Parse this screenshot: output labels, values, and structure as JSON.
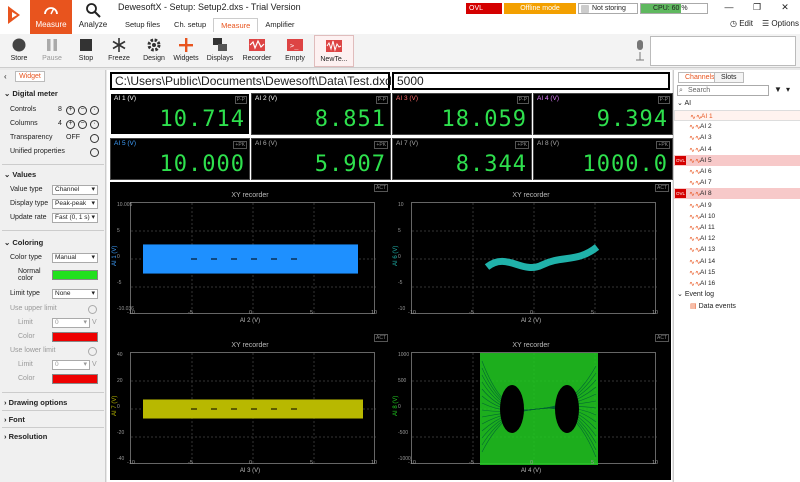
{
  "window": {
    "title": "DewesoftX - Setup: Setup2.dxs - Trial Version"
  },
  "ribbon": {
    "big_tabs": [
      {
        "label": "Measure"
      },
      {
        "label": "Analyze"
      }
    ],
    "sub_tabs": [
      "Setup files",
      "Ch. setup",
      "Measure",
      "Amplifier"
    ],
    "active_sub_tab": "Measure"
  },
  "status": {
    "ovl": "OVL",
    "mode": "Offline mode",
    "storing": "Not storing",
    "cpu": "CPU: 60 %",
    "cpu_percent": 60
  },
  "header_actions": {
    "edit": "Edit",
    "options": "Options"
  },
  "toolbar": {
    "store": "Store",
    "pause": "Pause",
    "stop": "Stop",
    "freeze": "Freeze",
    "design": "Design",
    "widgets": "Widgets",
    "displays": "Displays",
    "recorder": "Recorder",
    "empty": "Empty",
    "new_temp": "NewTe..."
  },
  "left_panel": {
    "tab": "Widget",
    "digital_meter": {
      "title": "Digital meter",
      "controls_label": "Controls",
      "controls_value": "8",
      "columns_label": "Columns",
      "columns_value": "4",
      "transparency_label": "Transparency",
      "transparency_value": "OFF",
      "unified_label": "Unified properties"
    },
    "values": {
      "title": "Values",
      "value_type_label": "Value type",
      "value_type": "Channel",
      "display_type_label": "Display type",
      "display_type": "Peak-peak",
      "update_rate_label": "Update rate",
      "update_rate": "Fast (0, 1 s)"
    },
    "coloring": {
      "title": "Coloring",
      "color_type_label": "Color type",
      "color_type": "Manual",
      "normal_color_label": "Normal color",
      "normal_color": "#22e01e",
      "limit_type_label": "Limit type",
      "limit_type": "None",
      "use_upper_label": "Use upper limit",
      "upper_limit_label": "Limit",
      "upper_limit_value": "0",
      "upper_unit": "V",
      "upper_color_label": "Color",
      "upper_color": "#ee0000",
      "use_lower_label": "Use lower limit",
      "lower_limit_label": "Limit",
      "lower_limit_value": "0",
      "lower_unit": "V",
      "lower_color_label": "Color",
      "lower_color": "#ee0000"
    },
    "drawing_options": "Drawing options",
    "font": "Font",
    "resolution": "Resolution"
  },
  "main": {
    "path_text": "C:\\Users\\Public\\Documents\\Dewesoft\\Data\\Test.dxd",
    "number_text": "5000",
    "meters": [
      {
        "label": "AI 1 (V)",
        "value": "10.714",
        "color": "#ffffff",
        "tag": "P-P"
      },
      {
        "label": "AI 2 (V)",
        "value": "8.851",
        "color": "#ffffff",
        "tag": "P-P"
      },
      {
        "label": "AI 3 (V)",
        "value": "18.059",
        "color": "#ff6a6a",
        "tag": "P-P"
      },
      {
        "label": "AI 4 (V)",
        "value": "9.394",
        "color": "#e080ff",
        "tag": "P-P"
      },
      {
        "label": "AI 5 (V)",
        "value": "10.000",
        "color": "#3fa0ff",
        "tag": "+PK"
      },
      {
        "label": "AI 6 (V)",
        "value": "5.907",
        "color": "#aaaaaa",
        "tag": "+PK"
      },
      {
        "label": "AI 7 (V)",
        "value": "8.344",
        "color": "#aaaaaa",
        "tag": "+PK"
      },
      {
        "label": "AI 8 (V)",
        "value": "1000.0",
        "color": "#aaaaaa",
        "tag": "+PK"
      }
    ],
    "graphs": [
      {
        "title": "XY recorder",
        "tag": "ACT",
        "xlabel": "AI 2 (V)",
        "ylabel": "AI 1 (V)",
        "ylabel_color": "#3fa0ff",
        "xticks": [
          "-10",
          "-5",
          "0",
          "5",
          "10"
        ],
        "yticks": [
          "10.005",
          "5",
          "0",
          "-5",
          "-10.036"
        ]
      },
      {
        "title": "XY recorder",
        "tag": "ACT",
        "xlabel": "AI 2 (V)",
        "ylabel": "AI 6 (V)",
        "ylabel_color": "#20b2aa",
        "xticks": [
          "-10",
          "-5",
          "0",
          "5",
          "10"
        ],
        "yticks": [
          "10",
          "5",
          "0",
          "-5",
          "-10"
        ]
      },
      {
        "title": "XY recorder",
        "tag": "ACT",
        "xlabel": "AI 3 (V)",
        "ylabel": "AI 7 (V)",
        "ylabel_color": "#b8b800",
        "xticks": [
          "-10",
          "-5",
          "0",
          "5",
          "10"
        ],
        "yticks": [
          "40",
          "20",
          "0",
          "-20",
          "-40"
        ]
      },
      {
        "title": "XY recorder",
        "tag": "ACT",
        "xlabel": "AI 4 (V)",
        "ylabel": "AI 8 (V)",
        "ylabel_color": "#22cc22",
        "xticks": [
          "-10",
          "-5",
          "0",
          "5",
          "10"
        ],
        "yticks": [
          "1000",
          "500",
          "0",
          "-500",
          "-1000"
        ]
      }
    ]
  },
  "right_panel": {
    "tabs": [
      "Channels",
      "Slots"
    ],
    "search_placeholder": "Search",
    "group_ai": "AI",
    "channels": [
      "AI 1",
      "AI 2",
      "AI 3",
      "AI 4",
      "AI 5",
      "AI 6",
      "AI 7",
      "AI 8",
      "AI 9",
      "AI 10",
      "AI 11",
      "AI 12",
      "AI 13",
      "AI 14",
      "AI 15",
      "AI 16"
    ],
    "event_log": "Event log",
    "data_events": "Data events",
    "ovl_chip": "OVL"
  }
}
